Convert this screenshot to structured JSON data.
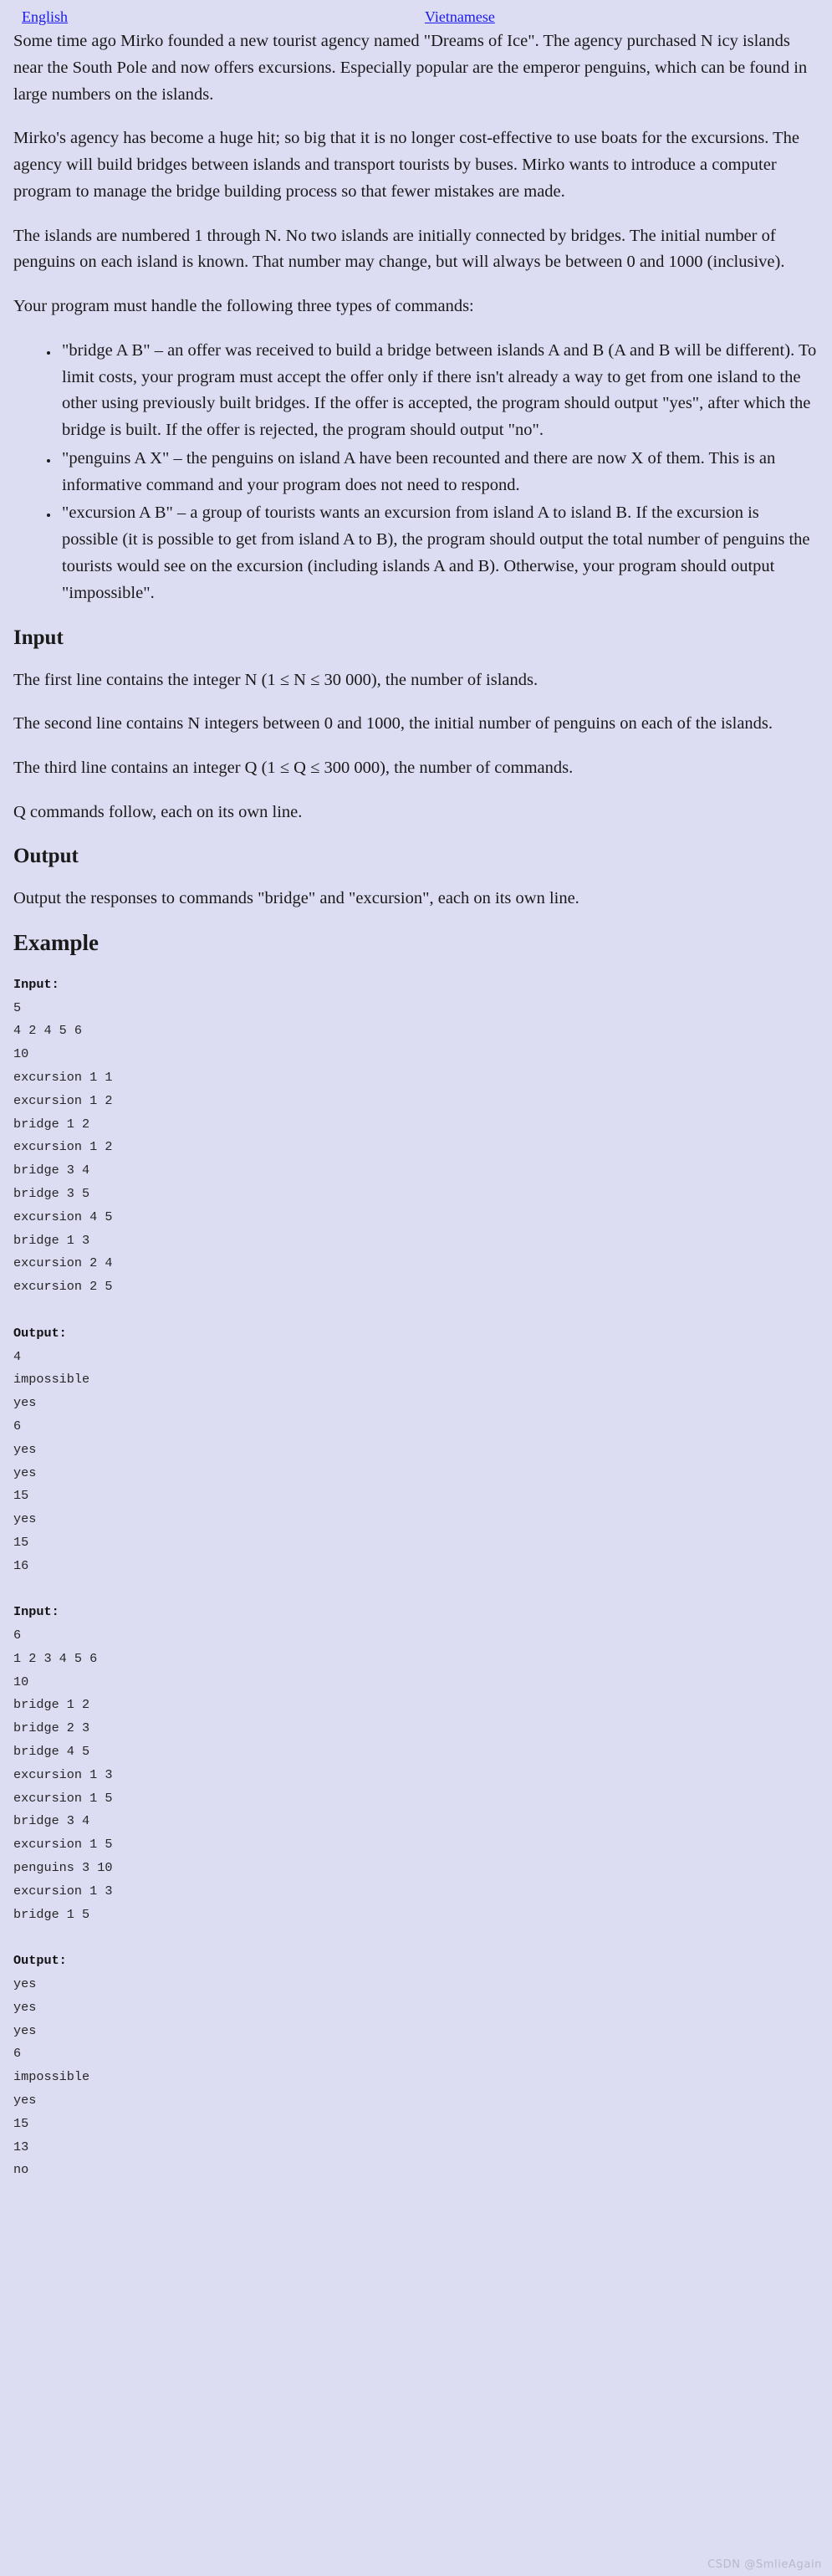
{
  "languages": [
    {
      "label": "English",
      "name": "lang-link-english"
    },
    {
      "label": "Vietnamese",
      "name": "lang-link-vietnamese"
    }
  ],
  "statement": {
    "paragraphs": [
      "Some time ago Mirko founded a new tourist agency named \"Dreams of Ice\". The agency purchased N icy islands near the South Pole and now offers excursions. Especially popular are the emperor penguins, which can be found in large numbers on the islands.",
      "Mirko's agency has become a huge hit; so big that it is no longer cost-effective to use boats for the excursions. The agency will build bridges between islands and transport tourists by buses. Mirko wants to introduce a computer program to manage the bridge building process so that fewer mistakes are made.",
      "The islands are numbered 1 through N. No two islands are initially connected by bridges. The initial number of penguins on each island is known. That number may change, but will always be between 0 and 1000 (inclusive).",
      "Your program must handle the following three types of commands:"
    ],
    "commands": [
      "\"bridge A B\" – an offer was received to build a bridge between islands A and B (A and B will be different). To limit costs, your program must accept the offer only if there isn't already a way to get from one island to the other using previously built bridges. If the offer is accepted, the program should output \"yes\", after which the bridge is built. If the offer is rejected, the program should output \"no\".",
      "\"penguins A X\" – the penguins on island A have been recounted and there are now X of them. This is an informative command and your program does not need to respond.",
      "\"excursion A B\" – a group of tourists wants an excursion from island A to island B. If the excursion is possible (it is possible to get from island A to B), the program should output the total number of penguins the tourists would see on the excursion (including islands A and B). Otherwise, your program should output \"impossible\"."
    ]
  },
  "input_section": {
    "heading": "Input",
    "paragraphs": [
      "The first line contains the integer N (1 ≤ N ≤ 30 000), the number of islands.",
      "The second line contains N integers between 0 and 1000, the initial number of penguins on each of the islands.",
      "The third line contains an integer Q (1 ≤ Q ≤ 300 000), the number of commands.",
      "Q commands follow, each on its own line."
    ]
  },
  "output_section": {
    "heading": "Output",
    "paragraphs": [
      "Output the responses to commands \"bridge\" and \"excursion\", each on its own line."
    ]
  },
  "example_section": {
    "heading": "Example",
    "input_label": "Input:",
    "output_label": "Output:",
    "examples": [
      {
        "input_lines": [
          "5",
          "4 2 4 5 6",
          "10",
          "excursion 1 1",
          "excursion 1 2",
          "bridge 1 2",
          "excursion 1 2",
          "bridge 3 4",
          "bridge 3 5",
          "excursion 4 5",
          "bridge 1 3",
          "excursion 2 4",
          "excursion 2 5"
        ],
        "output_lines": [
          "4",
          "impossible",
          "yes",
          "6",
          "yes",
          "yes",
          "15",
          "yes",
          "15",
          "16"
        ]
      },
      {
        "input_lines": [
          "6",
          "1 2 3 4 5 6",
          "10",
          "bridge 1 2",
          "bridge 2 3",
          "bridge 4 5",
          "excursion 1 3",
          "excursion 1 5",
          "bridge 3 4",
          "excursion 1 5",
          "penguins 3 10",
          "excursion 1 3",
          "bridge 1 5"
        ],
        "output_lines": [
          "yes",
          "yes",
          "yes",
          "6",
          "impossible",
          "yes",
          "15",
          "13",
          "no"
        ]
      }
    ]
  },
  "watermark": "CSDN @SmlieAgain",
  "colors": {
    "background": "#dcdcf2",
    "link": "#1a1aee",
    "text": "#1a1a1a",
    "code": "#262626",
    "watermark": "#b9b9cc"
  }
}
